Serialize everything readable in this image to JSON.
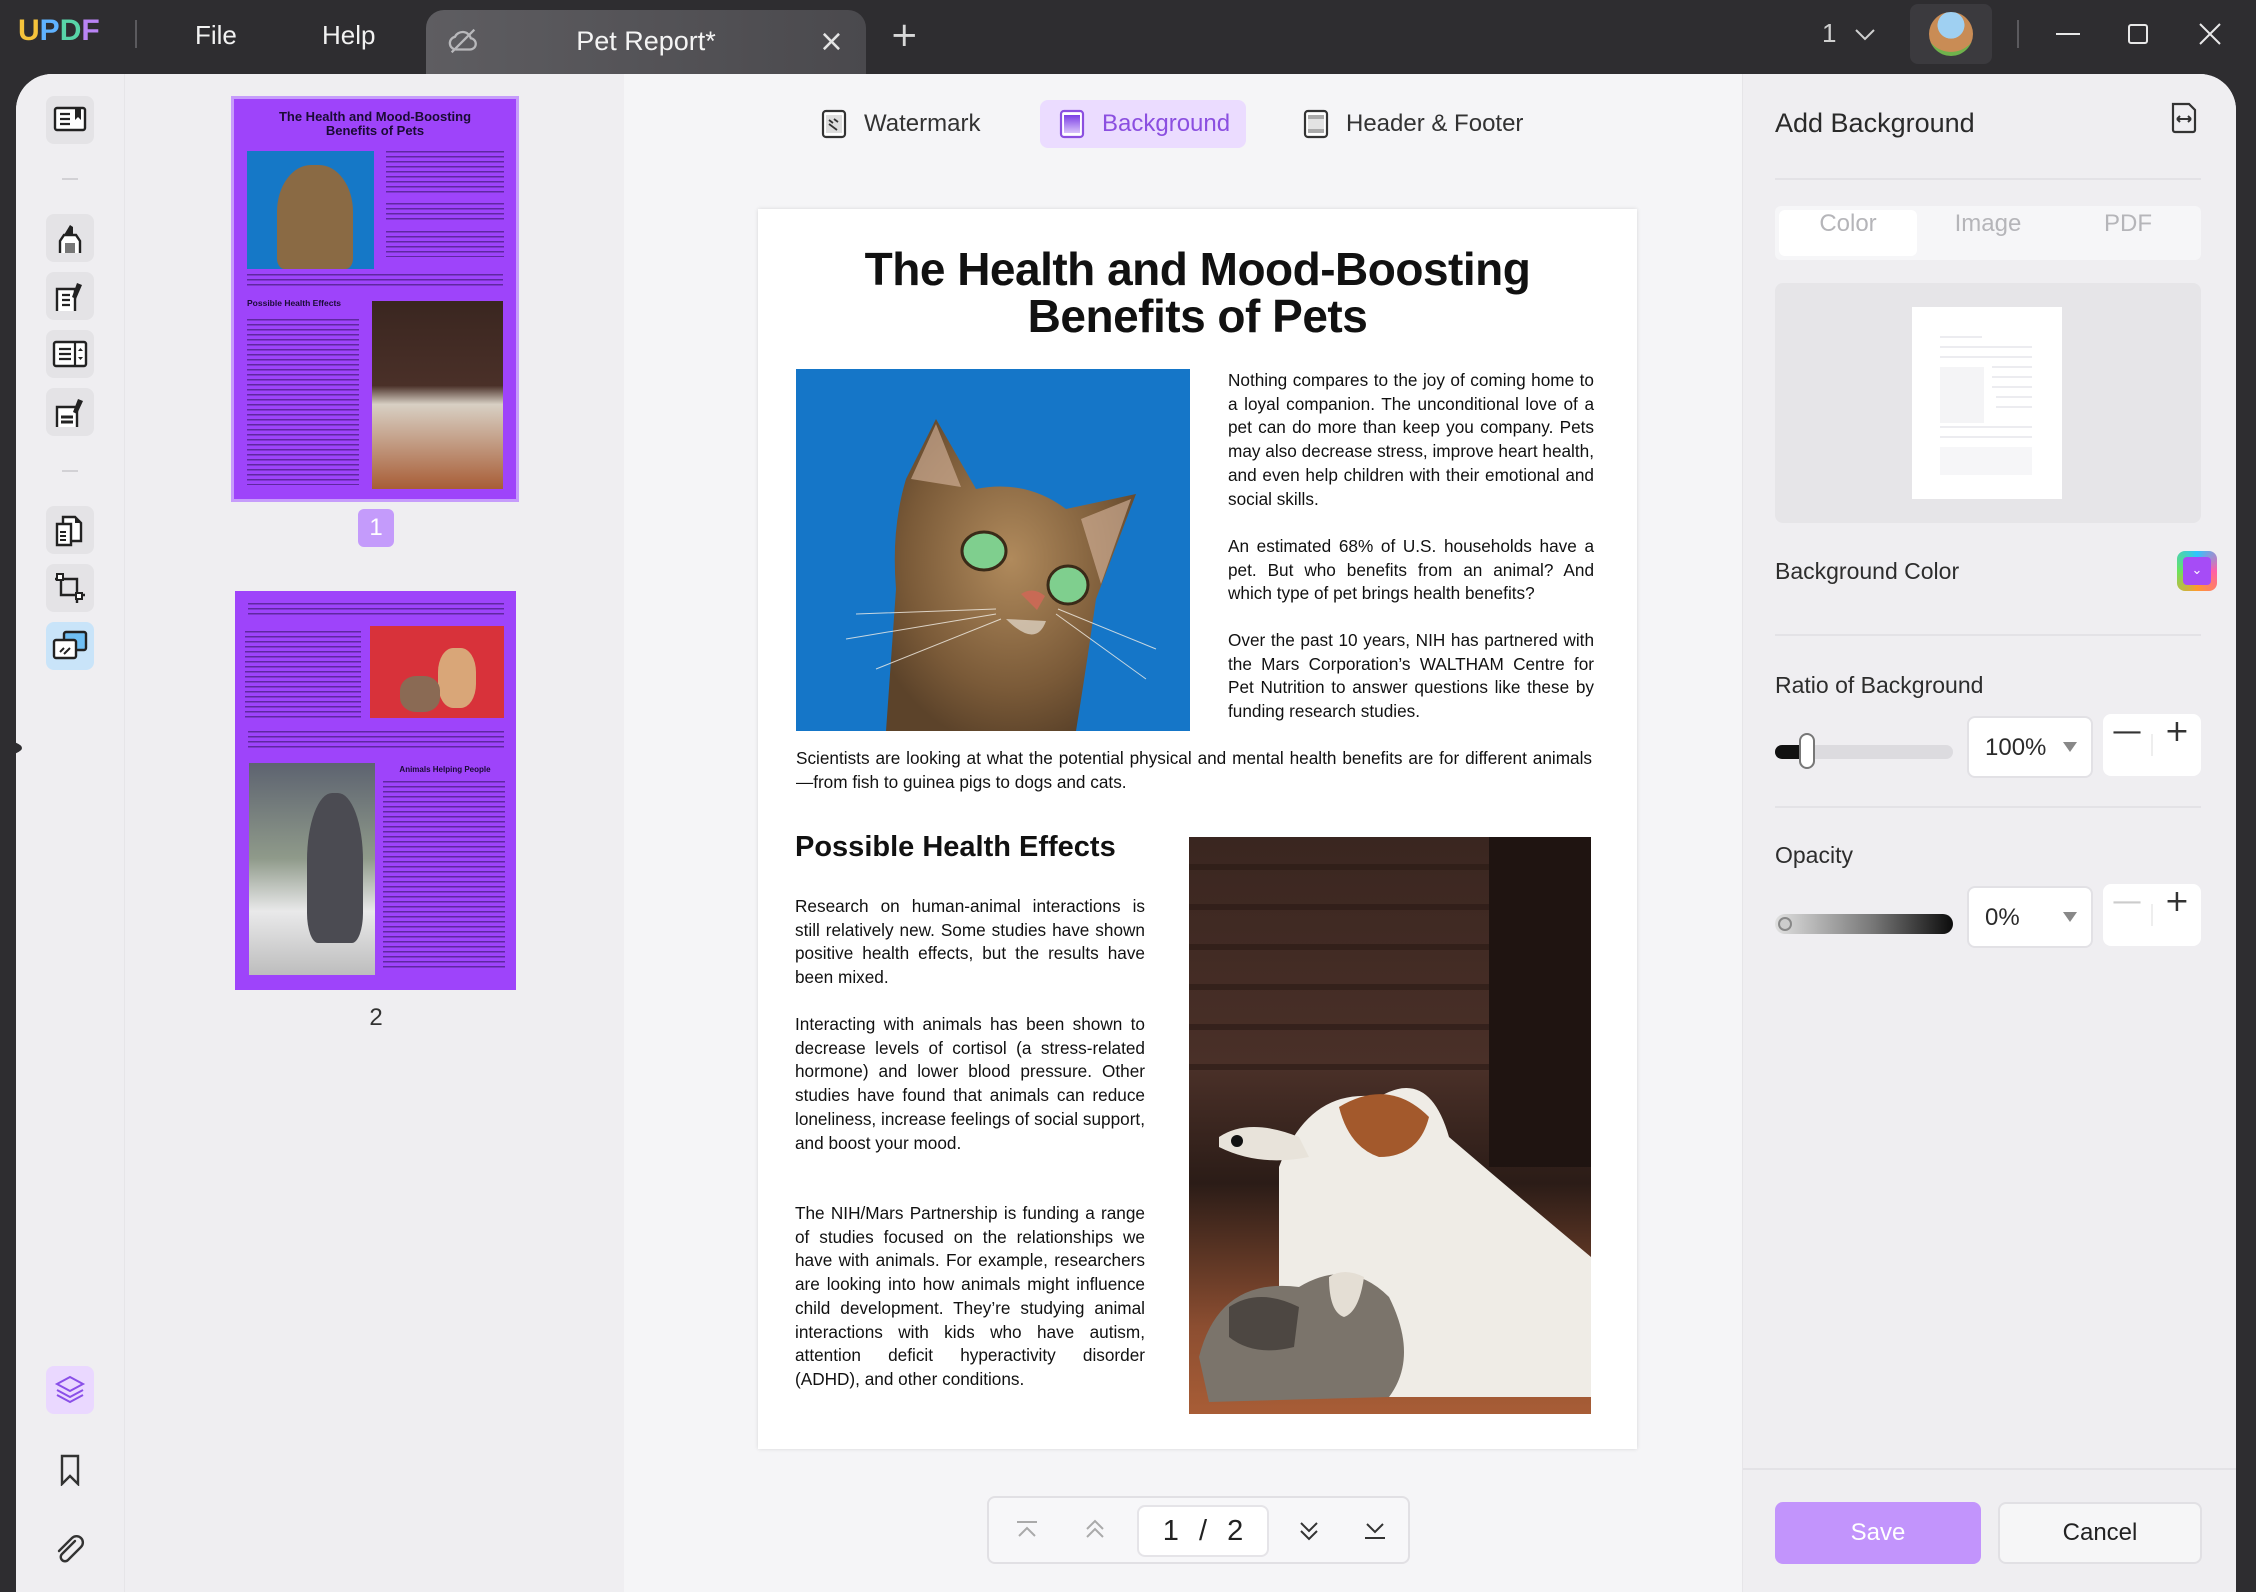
{
  "titlebar": {
    "logo": [
      "U",
      "P",
      "D",
      "F"
    ],
    "logo_colors": [
      "#f5c33b",
      "#5fb2ff",
      "#58d5a8",
      "#b984f5"
    ],
    "menu": [
      "File",
      "Help"
    ],
    "tab_title": "Pet Report*",
    "tab_close_icon": "×",
    "new_tab_icon": "+",
    "window_selector": "1",
    "controls": [
      "minimize",
      "maximize",
      "close"
    ]
  },
  "rail": {
    "top_items": [
      "reader",
      "comment",
      "edit-pdf",
      "form",
      "fill-sign",
      "organize-pages",
      "crop",
      "page-tools"
    ],
    "active": "page-tools",
    "bottom_items": [
      "layers",
      "bookmark",
      "attachment"
    ]
  },
  "thumbnails": {
    "pages": [
      {
        "number": "1",
        "selected": true,
        "title": "The Health and Mood-Boosting Benefits of Pets",
        "subheading": "Possible Health Effects"
      },
      {
        "number": "2",
        "selected": false,
        "subheading": "Animals Helping People"
      }
    ]
  },
  "toolbar": {
    "tabs": [
      {
        "label": "Watermark",
        "icon": "watermark-icon",
        "active": false
      },
      {
        "label": "Background",
        "icon": "background-icon",
        "active": true
      },
      {
        "label": "Header & Footer",
        "icon": "header-footer-icon",
        "active": false
      }
    ]
  },
  "document": {
    "title_line1": "The Health and Mood-Boosting",
    "title_line2": "Benefits of Pets",
    "intro_paragraphs": [
      "Nothing compares to the joy of coming home to a loyal companion. The unconditional love of a pet can do more than keep you company. Pets may also decrease stress, improve heart health, and even help children with their emotional and social skills.",
      "An estimated 68% of U.S. households have a pet. But who benefits from an animal? And which type of pet brings health benefits?",
      "Over the past 10 years, NIH has partnered with the Mars Corporation’s WALTHAM Centre for Pet Nutrition to answer questions like these by funding research studies."
    ],
    "full_width_paragraph": "Scientists are looking at what the potential physical and mental health benefits are for different animals—from fish to guinea pigs to dogs and cats.",
    "section_heading": "Possible Health Effects",
    "section_paragraphs": [
      "Research on human-animal interactions is still relatively new. Some studies have shown positive health effects, but the results have been mixed.",
      "Interacting with animals has been shown to decrease levels of cortisol (a stress-related hormone) and lower blood pressure. Other studies have found that animals can reduce loneliness, increase feelings of social support, and boost your mood.",
      "The NIH/Mars Partnership is funding a range of studies focused on the relationships we have with animals. For example, researchers are looking into how animals might influence child development. They’re studying animal interactions with kids who have autism, attention deficit hyperactivity disorder (ADHD), and other conditions."
    ],
    "images": [
      "cat-photo",
      "dog-and-cat-photo"
    ]
  },
  "page_nav": {
    "current": "1",
    "separator": "/",
    "total": "2"
  },
  "panel": {
    "title": "Add Background",
    "source_tabs": [
      "Color",
      "Image",
      "PDF"
    ],
    "selected_source": "Color",
    "background_color_label": "Background Color",
    "background_color": "#a64cf6",
    "ratio_label": "Ratio of Background",
    "ratio_value": "100%",
    "ratio_slider_fraction": 0.15,
    "opacity_label": "Opacity",
    "opacity_value": "0%",
    "opacity_slider_fraction": 0.0,
    "minus": "—",
    "plus": "+",
    "save_label": "Save",
    "cancel_label": "Cancel"
  }
}
